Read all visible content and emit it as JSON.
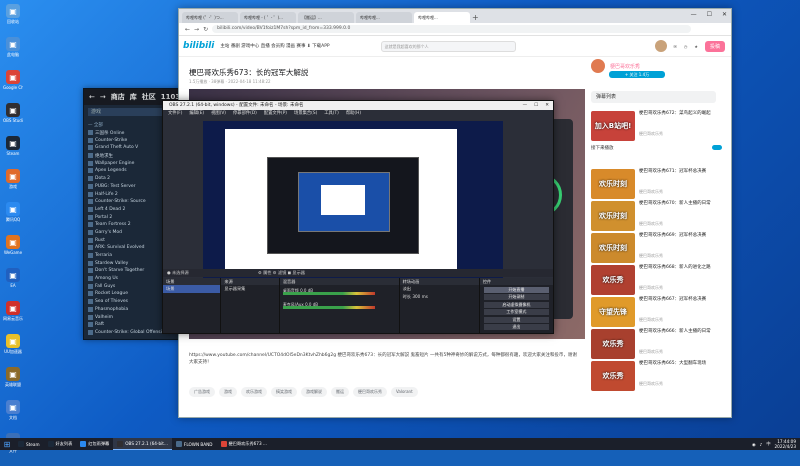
{
  "desktop": {
    "icons": [
      {
        "label": "回收站",
        "color": "#5aa0e0",
        "icon": "recycle-bin-icon"
      },
      {
        "label": "此电脑",
        "color": "#4a90d9",
        "icon": "computer-icon"
      },
      {
        "label": "Google Chrome",
        "color": "#db4437",
        "icon": "chrome-icon"
      },
      {
        "label": "OBS Studio",
        "color": "#302e31",
        "icon": "obs-icon"
      },
      {
        "label": "Steam",
        "color": "#1b2838",
        "icon": "steam-icon"
      },
      {
        "label": "游戏",
        "color": "#e06a2b",
        "icon": "game-icon"
      },
      {
        "label": "腾讯QQ",
        "color": "#2b8af0",
        "icon": "qq-icon"
      },
      {
        "label": "WeGame",
        "color": "#e0731f",
        "icon": "wegame-icon"
      },
      {
        "label": "EA",
        "color": "#2060c0",
        "icon": "ea-icon"
      },
      {
        "label": "网易云音乐",
        "color": "#d0302a",
        "icon": "music-icon"
      },
      {
        "label": "UU加速器",
        "color": "#e8c02a",
        "icon": "accelerator-icon"
      },
      {
        "label": "英雄联盟",
        "color": "#8a6a2a",
        "icon": "lol-icon"
      },
      {
        "label": "文档",
        "color": "#4a7fd0",
        "icon": "document-icon"
      },
      {
        "label": "文件",
        "color": "#3a6fb8",
        "icon": "file-icon"
      }
    ]
  },
  "steam": {
    "nav": [
      "商店",
      "库",
      "社区",
      "1103"
    ],
    "search_placeholder": "游戏",
    "items": [
      {
        "label": "— 全部",
        "head": true
      },
      {
        "label": "三国杀 Online",
        "head": false
      },
      {
        "label": "Counter-Strike",
        "head": false
      },
      {
        "label": "Grand Theft Auto V",
        "head": false
      },
      {
        "label": "绝地求生",
        "head": false
      },
      {
        "label": "Wallpaper Engine",
        "head": false
      },
      {
        "label": "Apex Legends",
        "head": false
      },
      {
        "label": "Dota 2",
        "head": false
      },
      {
        "label": "PUBG: Test Server",
        "head": false
      },
      {
        "label": "Half-Life 2",
        "head": false
      },
      {
        "label": "Counter-Strike: Source",
        "head": false
      },
      {
        "label": "Left 4 Dead 2",
        "head": false
      },
      {
        "label": "Portal 2",
        "head": false
      },
      {
        "label": "Team Fortress 2",
        "head": false
      },
      {
        "label": "Garry's Mod",
        "head": false
      },
      {
        "label": "Rust",
        "head": false
      },
      {
        "label": "ARK: Survival Evolved",
        "head": false
      },
      {
        "label": "Terraria",
        "head": false
      },
      {
        "label": "Stardew Valley",
        "head": false
      },
      {
        "label": "Don't Starve Together",
        "head": false
      },
      {
        "label": "Among Us",
        "head": false
      },
      {
        "label": "Fall Guys",
        "head": false
      },
      {
        "label": "Rocket League",
        "head": false
      },
      {
        "label": "Sea of Thieves",
        "head": false
      },
      {
        "label": "Phasmophobia",
        "head": false
      },
      {
        "label": "Valheim",
        "head": false
      },
      {
        "label": "Raft",
        "head": false
      },
      {
        "label": "Counter-Strike: Global Offensive",
        "head": false
      }
    ]
  },
  "browser": {
    "tabs": [
      "哔哩哔哩 (゜-゜)つ...",
      "哔哩哔哩 - ( ゜- ゜)...",
      "【搬运】...",
      "哔哩哔哩...",
      "哔哩哔哩..."
    ],
    "url": "bilibili.com/video/BV1foiz1M7sh?spm_id_from=333.999.0.0",
    "bili_nav": "主站  番剧  游戏中心  直播  会员购  漫画  赛事  ⬇ 下载APP",
    "search_placeholder": "这就是我超喜欢的那个人",
    "upload_label": "投稿",
    "video_title": "梗巴哥欢乐秀673：长的冠军大解説",
    "video_meta": "1.5万播放 · 38弹幕 · 2022-04-18 11:48:22",
    "description": "https://www.youtube.com/channel/UCTO4dOl5eDn3KtvhZhb6g2g 梗巴哥欢乐秀673：长的冠军大解説 鬼畜短片 一共有5种神奇妙的解说方式，每种都很有趣，欢迎大家关注和投币，谢谢大家支持！",
    "tags": [
      "广告游戏",
      "游戏",
      "欢乐游戏",
      "搞笑游戏",
      "游戏解说",
      "搬运",
      "梗巴哥欢乐秀",
      "Valorant"
    ],
    "up_name": "梗巴哥欢乐秀",
    "follow_label": "+ 关注 1.4万",
    "sidebar_title": "弹幕列表",
    "autoplay_label": "接下来播放",
    "recs": [
      {
        "title": "梗巴哥欢乐秀672：菜鸟起义的崛起",
        "uploader": "梗巴哥欢乐秀",
        "thumb": "加入B站吧!",
        "color": "#c7423a"
      },
      {
        "title": "梗巴哥欢乐秀671：冠军杯总决赛",
        "uploader": "梗巴哥欢乐秀",
        "thumb": "欢乐时刻",
        "color": "#d88a2a"
      },
      {
        "title": "梗巴哥欢乐秀670：新人主播的日常",
        "uploader": "梗巴哥欢乐秀",
        "thumb": "欢乐时刻",
        "color": "#d0902e"
      },
      {
        "title": "梗巴哥欢乐秀669：冠军杯总决赛",
        "uploader": "梗巴哥欢乐秀",
        "thumb": "欢乐时刻",
        "color": "#cc8a2c"
      },
      {
        "title": "梗巴哥欢乐秀668：新人的进化之路",
        "uploader": "梗巴哥欢乐秀",
        "thumb": "欢乐秀",
        "color": "#b04030"
      },
      {
        "title": "梗巴哥欢乐秀667：冠军杯总决赛",
        "uploader": "梗巴哥欢乐秀",
        "thumb": "守望先锋",
        "color": "#e09a2a"
      },
      {
        "title": "梗巴哥欢乐秀666：新人主播的日常",
        "uploader": "梗巴哥欢乐秀",
        "thumb": "欢乐秀",
        "color": "#a8402e"
      },
      {
        "title": "梗巴哥欢乐秀665：大型翻车现场",
        "uploader": "梗巴哥欢乐秀",
        "thumb": "欢乐秀",
        "color": "#c04a30"
      }
    ]
  },
  "obs": {
    "title": "OBS 27.2.1 (64-bit, windows) - 配置文件: 未命名 - 场景: 未命名",
    "menu": [
      "文件(F)",
      "编辑(E)",
      "视图(V)",
      "停靠部件(D)",
      "配置文件(P)",
      "场景集合(S)",
      "工具(T)",
      "帮助(H)"
    ],
    "status_left": "● 未选择源",
    "status_right": "⚙ 属性   ⚙ 滤镜   ◼ 显示器",
    "scenes_title": "场景",
    "scenes": [
      "场景"
    ],
    "sources_title": "来源",
    "sources": [
      "显示器采集"
    ],
    "mixer_title": "混音器",
    "mixer_rows": [
      "桌面音频   0.0 dB",
      "麦克风/Aux   0.0 dB"
    ],
    "transition_title": "转场动画",
    "transition_value": "淡出",
    "duration_label": "时长",
    "duration_value": "300 ms",
    "controls_title": "控件",
    "controls": [
      "开始直播",
      "开始录制",
      "启动虚拟摄像机",
      "工作室模式",
      "设置",
      "退出"
    ]
  },
  "taskbar": {
    "items": [
      {
        "label": "Steam",
        "color": "#1b2838"
      },
      {
        "label": "好友列表",
        "color": "#1b2838"
      },
      {
        "label": "红包雨弹幕",
        "color": "#2b8af0"
      },
      {
        "label": "OBS 27.2.1 (64-bit...",
        "color": "#302e31"
      },
      {
        "label": "FLOWN BAND",
        "color": "#4a6a8a"
      },
      {
        "label": "梗巴哥欢乐秀673 ...",
        "color": "#db4437"
      }
    ],
    "time": "17:44:09",
    "date": "2022/4/23",
    "lang": "中"
  }
}
